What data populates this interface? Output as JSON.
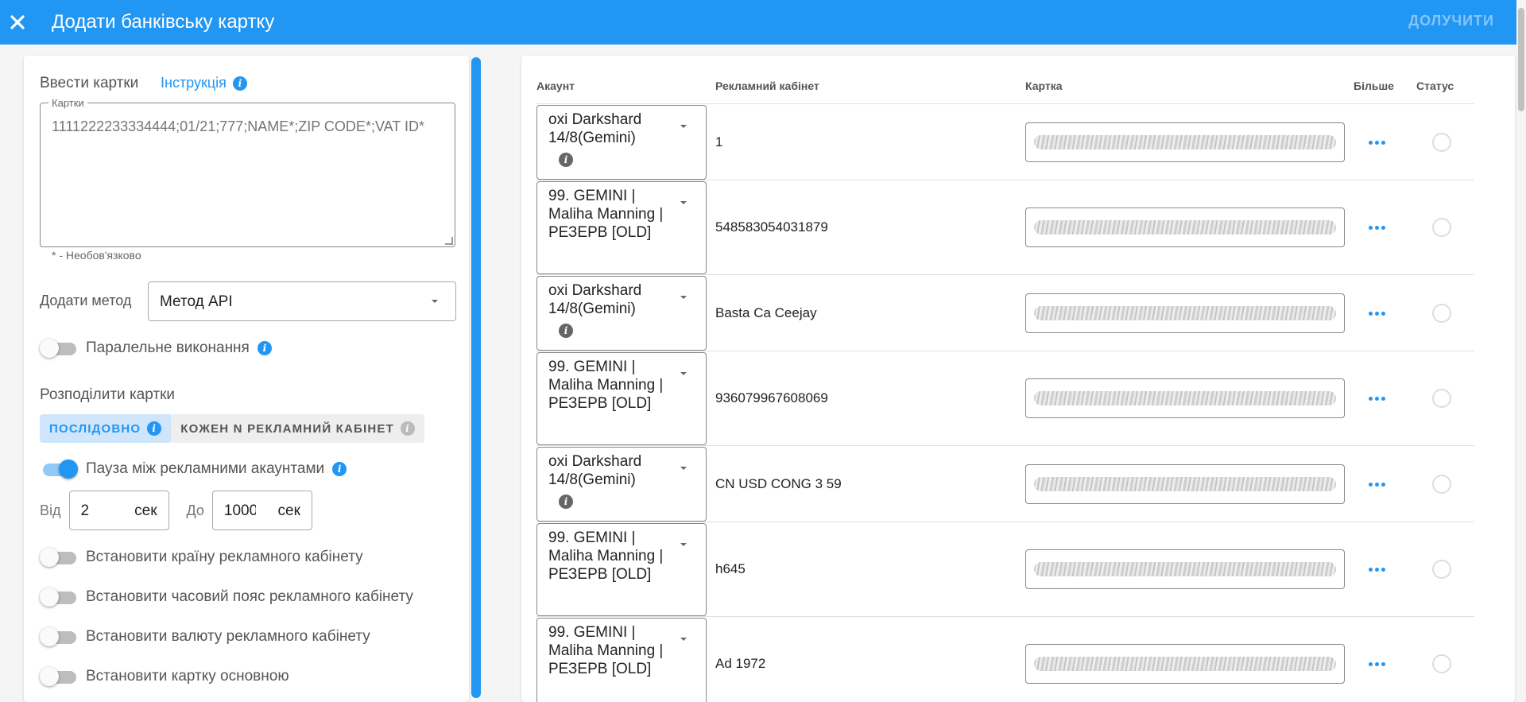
{
  "header": {
    "title": "Додати банківську картку",
    "action_label": "ДОЛУЧИТИ",
    "close_icon": "close-icon"
  },
  "left": {
    "cards_heading": "Ввести картки",
    "instruction_link": "Інструкція",
    "textarea_legend": "Картки",
    "textarea_placeholder": "1111222233334444;01/21;777;NAME*;ZIP CODE*;VAT ID*",
    "optional_hint": "* - Необов'язково",
    "method_label": "Додати метод",
    "method_value": "Метод API",
    "parallel_label": "Паралельне виконання",
    "parallel_on": false,
    "split_heading": "Розподілити картки",
    "split_options": [
      "ПОСЛІДОВНО",
      "КОЖЕН N РЕКЛАМНИЙ КАБІНЕТ"
    ],
    "split_selected": "ПОСЛІДОВНО",
    "pause_label": "Пауза між рекламними акаунтами",
    "pause_on": true,
    "from_label": "Від",
    "from_value": "2",
    "to_label": "До",
    "to_value": "1000",
    "unit": "сек",
    "toggles": [
      {
        "label": "Встановити країну рекламного кабінету",
        "on": false
      },
      {
        "label": "Встановити часовий пояс рекламного кабінету",
        "on": false
      },
      {
        "label": "Встановити валюту рекламного кабінету",
        "on": false
      },
      {
        "label": "Встановити картку основною",
        "on": false
      }
    ]
  },
  "table": {
    "columns": [
      "Акаунт",
      "Рекламний кабінет",
      "Картка",
      "Більше",
      "Статус"
    ],
    "rows": [
      {
        "account": "oxi Darkshard 14/8(Gemini)",
        "cabinet": "1",
        "has_info": true
      },
      {
        "account": "99. GEMINI | Maliha Manning | РЕЗЕРВ [OLD]",
        "cabinet": "548583054031879",
        "has_info": false
      },
      {
        "account": "oxi Darkshard 14/8(Gemini)",
        "cabinet": "Basta Ca Ceejay",
        "has_info": true
      },
      {
        "account": "99. GEMINI | Maliha Manning | РЕЗЕРВ [OLD]",
        "cabinet": "936079967608069",
        "has_info": false
      },
      {
        "account": "oxi Darkshard 14/8(Gemini)",
        "cabinet": "CN USD CONG 3 59",
        "has_info": true
      },
      {
        "account": "99. GEMINI | Maliha Manning | РЕЗЕРВ [OLD]",
        "cabinet": "h645",
        "has_info": false
      },
      {
        "account": "99. GEMINI | Maliha Manning | РЕЗЕРВ [OLD]",
        "cabinet": "Ad 1972",
        "has_info": false
      }
    ]
  },
  "colors": {
    "primary": "#2196f3",
    "background": "#f5f5f5"
  }
}
